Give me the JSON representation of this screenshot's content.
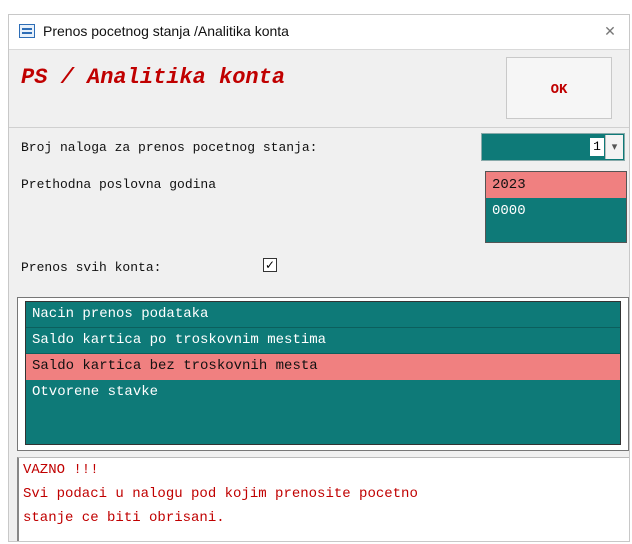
{
  "window": {
    "title": "Prenos pocetnog stanja /Analitika konta",
    "close_glyph": "✕",
    "app_icon": "form-icon"
  },
  "header": {
    "title": "PS / Analitika konta",
    "ok_label": "OK"
  },
  "form": {
    "broj_naloga_label": "Broj naloga za prenos pocetnog stanja:",
    "broj_naloga_value": "1",
    "dropdown_glyph": "▾",
    "prethodna_godina_label": "Prethodna poslovna godina",
    "years": [
      {
        "label": "2023",
        "selected": true
      },
      {
        "label": "0000",
        "selected": false
      }
    ],
    "prenos_svih_label": "Prenos svih konta:",
    "prenos_svih_checked": true,
    "check_glyph": "✓"
  },
  "method_list": {
    "header": "Nacin prenos podataka",
    "options": [
      {
        "label": "Saldo kartica po troskovnim mestima",
        "selected": false
      },
      {
        "label": "Saldo kartica bez troskovnih mesta",
        "selected": true
      },
      {
        "label": "Otvorene stavke",
        "selected": false
      }
    ]
  },
  "warning": {
    "line1": "VAZNO !!!",
    "line2": "Svi podaci u nalogu pod kojim prenosite pocetno",
    "line3": "stanje ce biti obrisani."
  },
  "colors": {
    "teal": "#0e7a78",
    "selection": "#f08080",
    "accent_red": "#c00000"
  }
}
